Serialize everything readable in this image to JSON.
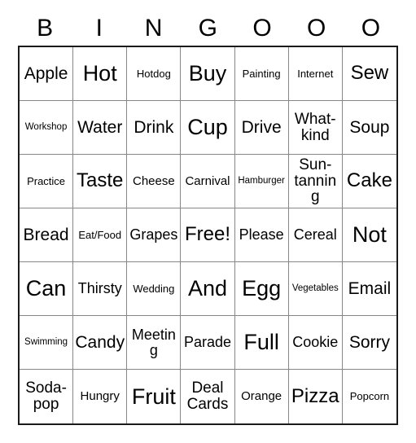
{
  "card": {
    "title": "Bingo Card",
    "columns": 7,
    "rows": 7,
    "background_color": "#ffffff",
    "outer_border_color": "#1a1a1a",
    "inner_grid_color": "#878787",
    "text_color": "#000000"
  },
  "header": {
    "letters": [
      "B",
      "I",
      "N",
      "G",
      "O",
      "O",
      "O"
    ]
  },
  "grid": {
    "rows": [
      [
        {
          "text": "Apple",
          "size": "fs-l"
        },
        {
          "text": "Hot",
          "size": "fs-xxl"
        },
        {
          "text": "Hotdog",
          "size": "fs-xs"
        },
        {
          "text": "Buy",
          "size": "fs-xxl"
        },
        {
          "text": "Painting",
          "size": "fs-xs"
        },
        {
          "text": "Internet",
          "size": "fs-xs"
        },
        {
          "text": "Sew",
          "size": "fs-xl"
        }
      ],
      [
        {
          "text": "Workshop",
          "size": "fs-xxs"
        },
        {
          "text": "Water",
          "size": "fs-l"
        },
        {
          "text": "Drink",
          "size": "fs-l"
        },
        {
          "text": "Cup",
          "size": "fs-xxl"
        },
        {
          "text": "Drive",
          "size": "fs-l"
        },
        {
          "text": "What-\nkind",
          "size": "fs-two"
        },
        {
          "text": "Soup",
          "size": "fs-l"
        }
      ],
      [
        {
          "text": "Practice",
          "size": "fs-xs"
        },
        {
          "text": "Taste",
          "size": "fs-xl"
        },
        {
          "text": "Cheese",
          "size": "fs-s"
        },
        {
          "text": "Carnival",
          "size": "fs-s"
        },
        {
          "text": "Hamburger",
          "size": "fs-xxs"
        },
        {
          "text": "Sun-\ntanning",
          "size": "fs-two"
        },
        {
          "text": "Cake",
          "size": "fs-xl"
        }
      ],
      [
        {
          "text": "Bread",
          "size": "fs-l"
        },
        {
          "text": "Eat/Food",
          "size": "fs-xs"
        },
        {
          "text": "Grapes",
          "size": "fs-m"
        },
        {
          "text": "Free!",
          "size": "fs-xl"
        },
        {
          "text": "Please",
          "size": "fs-m"
        },
        {
          "text": "Cereal",
          "size": "fs-m"
        },
        {
          "text": "Not",
          "size": "fs-xxl"
        }
      ],
      [
        {
          "text": "Can",
          "size": "fs-xxl"
        },
        {
          "text": "Thirsty",
          "size": "fs-m"
        },
        {
          "text": "Wedding",
          "size": "fs-xs"
        },
        {
          "text": "And",
          "size": "fs-xxl"
        },
        {
          "text": "Egg",
          "size": "fs-xxl"
        },
        {
          "text": "Vegetables",
          "size": "fs-xxs"
        },
        {
          "text": "Email",
          "size": "fs-l"
        }
      ],
      [
        {
          "text": "Swimming",
          "size": "fs-xxs"
        },
        {
          "text": "Candy",
          "size": "fs-l"
        },
        {
          "text": "Meeting",
          "size": "fs-m"
        },
        {
          "text": "Parade",
          "size": "fs-m"
        },
        {
          "text": "Full",
          "size": "fs-xxl"
        },
        {
          "text": "Cookie",
          "size": "fs-m"
        },
        {
          "text": "Sorry",
          "size": "fs-l"
        }
      ],
      [
        {
          "text": "Soda-\npop",
          "size": "fs-two"
        },
        {
          "text": "Hungry",
          "size": "fs-s"
        },
        {
          "text": "Fruit",
          "size": "fs-xxl"
        },
        {
          "text": "Deal\nCards",
          "size": "fs-two"
        },
        {
          "text": "Orange",
          "size": "fs-s"
        },
        {
          "text": "Pizza",
          "size": "fs-xl"
        },
        {
          "text": "Popcorn",
          "size": "fs-xs"
        }
      ]
    ]
  }
}
